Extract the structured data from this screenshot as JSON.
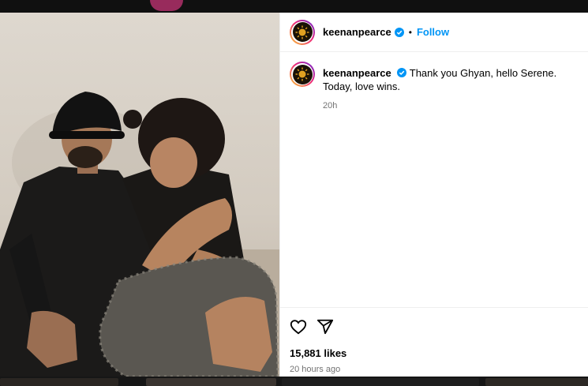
{
  "post": {
    "username": "keenanpearce",
    "follow_label": "Follow",
    "separator": "•",
    "caption_text": "Thank you Ghyan, hello Serene. Today, love wins.",
    "caption_time": "20h",
    "likes": "15,881 likes",
    "posted_ago": "20 hours ago"
  },
  "icons": {
    "verified": "verified-badge-icon",
    "like": "heart-icon",
    "share": "send-icon"
  },
  "colors": {
    "accent": "#0095f6",
    "verified": "#0095f6",
    "muted_text": "#737373"
  }
}
